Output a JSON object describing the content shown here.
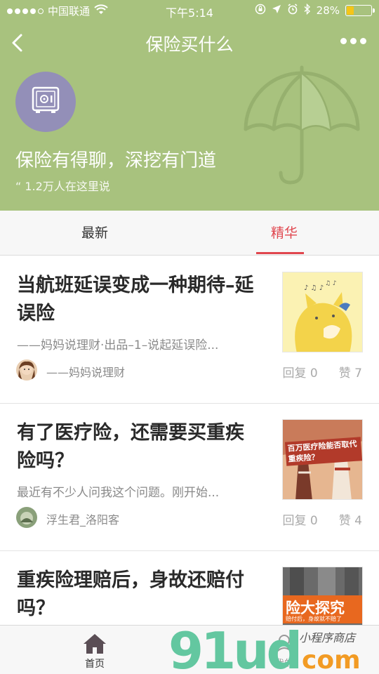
{
  "status_bar": {
    "carrier": "中国联通",
    "time": "下午5:14",
    "battery": "28%",
    "battery_level": 0.28
  },
  "header": {
    "title": "保险买什么",
    "tagline": "保险有得聊，深挖有门道",
    "members": "“ 1.2万人在这里说"
  },
  "tabs": [
    {
      "label": "最新",
      "active": false
    },
    {
      "label": "精华",
      "active": true
    }
  ],
  "articles": [
    {
      "title": "当航班延误变成一种期待–延误险",
      "summary": "——妈妈说理财·出品–1–说起延误险...",
      "author": "——妈妈说理财",
      "replies": "回复 0",
      "likes": "赞 7"
    },
    {
      "title": "有了医疗险，还需要买重疾险吗？",
      "summary": "最近有不少人问我这个问题。刚开始...",
      "author": "浮生君_洛阳客",
      "replies": "回复 0",
      "likes": "赞 4",
      "thumb_text": "百万医疗险能否取代重疾险？"
    },
    {
      "title": "重疾险理赔后，身故还赔付吗？",
      "thumb_text": "险大探究",
      "thumb_subtext": "赔付后，身故就不赔了"
    }
  ],
  "tabbar": {
    "home_label": "首页",
    "mine_label": "我的"
  },
  "watermark": {
    "brand": "91ud",
    "suffix": "com",
    "script": "小程序商店"
  },
  "colors": {
    "header_green": "#a8c27e",
    "accent_red": "#e0464e",
    "avatar_purple": "#938fb8",
    "watermark_green": "#63c7a0",
    "watermark_orange": "#f29b24"
  }
}
